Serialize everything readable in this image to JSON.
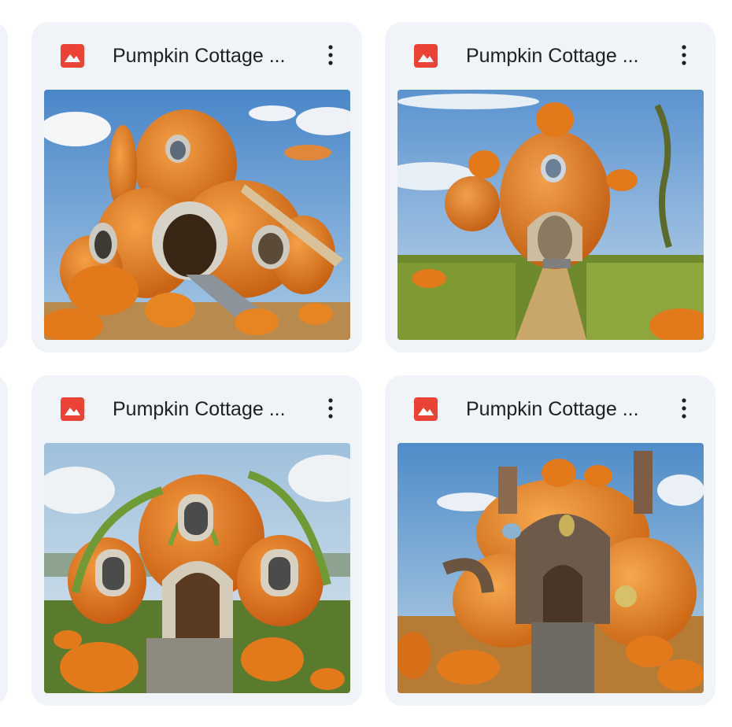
{
  "files": [
    {
      "title": "Pumpkin Cottage ...",
      "icon": "image-file-icon",
      "menu_icon": "more-vert-icon",
      "scene": "cottage-with-stairs"
    },
    {
      "title": "Pumpkin Cottage ...",
      "icon": "image-file-icon",
      "menu_icon": "more-vert-icon",
      "scene": "cottage-with-path"
    },
    {
      "title": "Pumpkin Cottage ...",
      "icon": "image-file-icon",
      "menu_icon": "more-vert-icon",
      "scene": "cottage-with-ivy"
    },
    {
      "title": "Pumpkin Cottage ...",
      "icon": "image-file-icon",
      "menu_icon": "more-vert-icon",
      "scene": "cottage-whimsical"
    }
  ],
  "colors": {
    "card_bg": "#f0f4f9",
    "icon_red": "#ea4335",
    "title_text": "#1f1f1f",
    "pumpkin": "#e27a1c"
  }
}
